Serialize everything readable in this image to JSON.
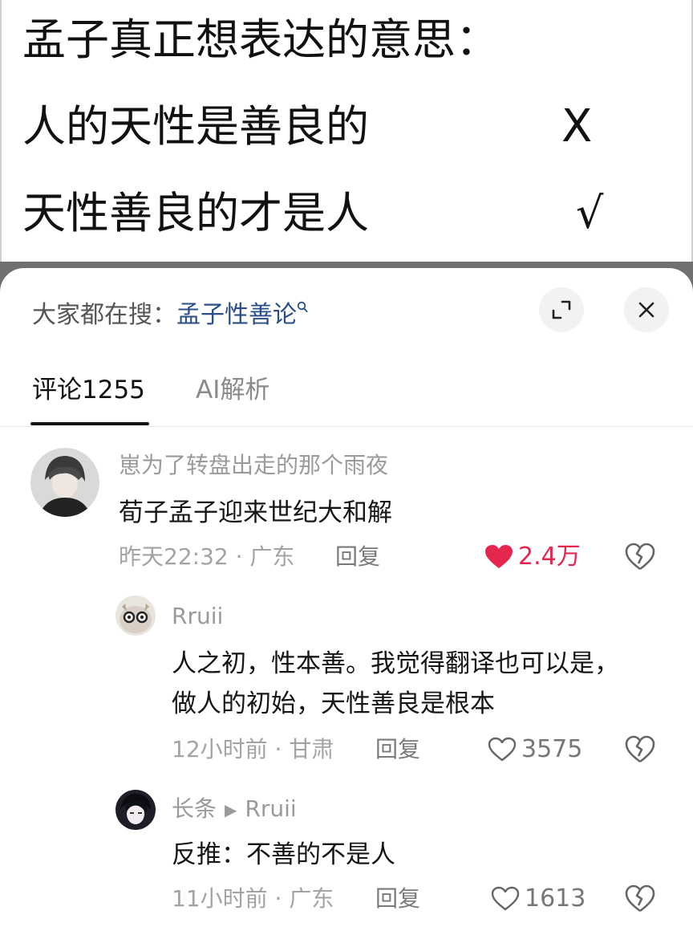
{
  "caption": {
    "line1": "孟子真正想表达的意思：",
    "line2": "人的天性是善良的",
    "line2_mark": "X",
    "line3": "天性善良的才是人",
    "line3_mark": "√"
  },
  "search": {
    "label": "大家都在搜：",
    "term": "孟子性善论",
    "icon": "search-icon"
  },
  "header_icons": {
    "expand": "expand-icon",
    "close": "close-icon"
  },
  "tabs": [
    {
      "label": "评论1255",
      "active": true
    },
    {
      "label": "AI解析",
      "active": false
    }
  ],
  "comments": [
    {
      "username": "崽为了转盘出走的那个雨夜",
      "text": "荀子孟子迎来世纪大和解",
      "time_location": "昨天22:32 · 广东",
      "reply_label": "回复",
      "likes": "2.4万",
      "liked": true
    },
    {
      "username": "Rruii",
      "text_line1": "人之初，性本善。我觉得翻译也可以是，",
      "text_line2": "做人的初始，天性善良是根本",
      "time_location": "12小时前 · 甘肃",
      "reply_label": "回复",
      "likes": "3575",
      "liked": false
    },
    {
      "username": "长条",
      "reply_to": "Rruii",
      "text": "反推：不善的不是人",
      "time_location": "11小时前 · 广东",
      "reply_label": "回复",
      "likes": "1613",
      "liked": false
    }
  ],
  "colors": {
    "accent_link": "#2b4e88",
    "like_red": "#e5264f",
    "band_grey": "#707070"
  }
}
